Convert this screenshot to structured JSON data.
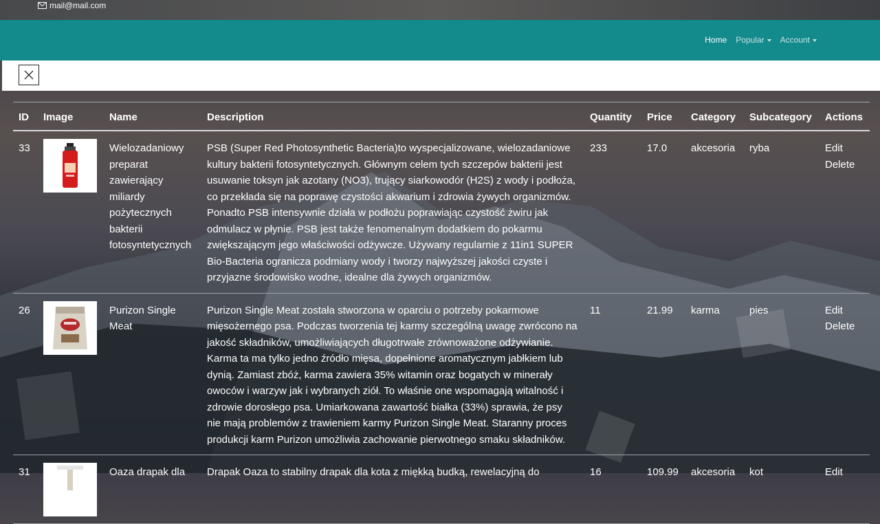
{
  "header": {
    "email": "mail@mail.com"
  },
  "nav": {
    "home": "Home",
    "popular": "Popular",
    "account": "Account"
  },
  "table": {
    "columns": [
      "ID",
      "Image",
      "Name",
      "Description",
      "Quantity",
      "Price",
      "Category",
      "Subcategory",
      "Actions"
    ],
    "rows": [
      {
        "id": "33",
        "image": "red-spray-bottle",
        "name": "Wielozadaniowy preparat zawierający miliardy pożytecznych bakterii fotosyntetycznych",
        "description": "PSB (Super Red Photosynthetic Bacteria)to wyspecjalizowane, wielozadaniowe kultury bakterii fotosyntetycznych. Głównym celem tych szczepów bakterii jest usuwanie toksyn jak azotany (NO3), trujący siarkowodór (H2S) z wody i podłoża, co przekłada się na poprawę czystości akwarium i zdrowia żywych organizmów. Ponadto PSB intensywnie działa w podłożu poprawiając czystość żwiru jak odmulacz w płynie. PSB jest także fenomenalnym dodatkiem do pokarmu zwiększającym jego właściwości odżywcze. Używany regularnie z 11in1 SUPER Bio-Bacteria ogranicza podmiany wody i tworzy najwyższej jakości czyste i przyjazne środowisko wodne, idealne dla żywych organizmów.",
        "quantity": "233",
        "price": "17.0",
        "category": "akcesoria",
        "subcategory": "ryba",
        "edit": "Edit",
        "delete": "Delete"
      },
      {
        "id": "26",
        "image": "dog-food-bag",
        "name": "Purizon Single Meat",
        "description": "Purizon Single Meat została stworzona w oparciu o potrzeby pokarmowe mięsożernego psa. Podczas tworzenia tej karmy szczególną uwagę zwrócono na jakość składników, umożliwiających długotrwałe zrównoważone odżywianie. Karma ta ma tylko jedno źródło mięsa, dopełnione aromatycznym jabłkiem lub dynią. Zamiast zbóż, karma zawiera 35% witamin oraz bogatych w minerały owoców i warzyw jak i wybranych ziół. To właśnie one wspomagają witalność i zdrowie dorosłego psa. Umiarkowana zawartość białka (33%) sprawia, że psy nie mają problemów z trawieniem karmy Purizon Single Meat. Staranny proces produkcji karm Purizon umożliwia zachowanie pierwotnego smaku składników.",
        "quantity": "11",
        "price": "21.99",
        "category": "karma",
        "subcategory": "pies",
        "edit": "Edit",
        "delete": "Delete"
      },
      {
        "id": "31",
        "image": "cat-scratcher",
        "name": "Oaza drapak dla",
        "description": "Drapak Oaza to stabilny drapak dla kota z miękką budką, rewelacyjną do",
        "quantity": "16",
        "price": "109.99",
        "category": "akcesoria",
        "subcategory": "kot",
        "edit": "Edit",
        "delete": ""
      }
    ]
  }
}
